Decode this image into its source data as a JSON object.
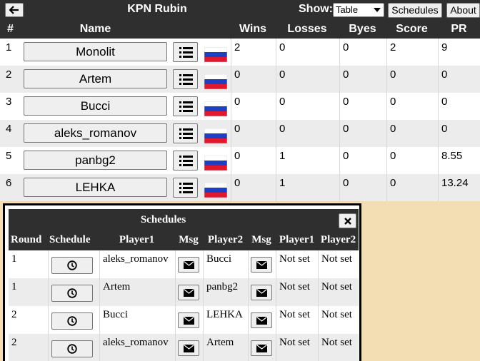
{
  "header": {
    "back_icon": "arrow-left-icon",
    "title": "KPN Rubin",
    "show_label": "Show:",
    "view_select": "Table",
    "schedules_button": "Schedules",
    "about_button": "About"
  },
  "standings": {
    "columns": [
      "#",
      "Name",
      "Wins",
      "Losses",
      "Byes",
      "Score",
      "PR"
    ],
    "rows": [
      {
        "rank": "1",
        "name": "Monolit",
        "wins": "2",
        "losses": "0",
        "byes": "0",
        "score": "2",
        "pr": "9"
      },
      {
        "rank": "2",
        "name": "Artem",
        "wins": "0",
        "losses": "0",
        "byes": "0",
        "score": "0",
        "pr": "0"
      },
      {
        "rank": "3",
        "name": "Bucci",
        "wins": "0",
        "losses": "0",
        "byes": "0",
        "score": "0",
        "pr": "0"
      },
      {
        "rank": "4",
        "name": "aleks_romanov",
        "wins": "0",
        "losses": "0",
        "byes": "0",
        "score": "0",
        "pr": "0"
      },
      {
        "rank": "5",
        "name": "panbg2",
        "wins": "0",
        "losses": "1",
        "byes": "0",
        "score": "0",
        "pr": "8.55"
      },
      {
        "rank": "6",
        "name": "LEHKA",
        "wins": "0",
        "losses": "1",
        "byes": "0",
        "score": "0",
        "pr": "13.24"
      }
    ],
    "list_icon": "list-icon",
    "flag_icon": "russia-flag-icon"
  },
  "schedules": {
    "title": "Schedules",
    "close_icon": "close-icon",
    "columns": [
      "Round",
      "Schedule",
      "Player1",
      "Msg",
      "Player2",
      "Msg",
      "Player1",
      "Player2"
    ],
    "rows": [
      {
        "round": "1",
        "player1": "aleks_romanov",
        "player2": "Bucci",
        "p1_status": "Not set",
        "p2_status": "Not set"
      },
      {
        "round": "1",
        "player1": "Artem",
        "player2": "panbg2",
        "p1_status": "Not set",
        "p2_status": "Not set"
      },
      {
        "round": "2",
        "player1": "Bucci",
        "player2": "LEHKA",
        "p1_status": "Not set",
        "p2_status": "Not set"
      },
      {
        "round": "2",
        "player1": "aleks_romanov",
        "player2": "Artem",
        "p1_status": "Not set",
        "p2_status": "Not set"
      }
    ],
    "clock_icon": "clock-icon",
    "message_icon": "envelope-icon"
  },
  "colors": {
    "header_bg": "#2f2f2f",
    "page_bg": "#f3deb3",
    "row_alt": "#ececec",
    "button_bg": "#efefef"
  }
}
